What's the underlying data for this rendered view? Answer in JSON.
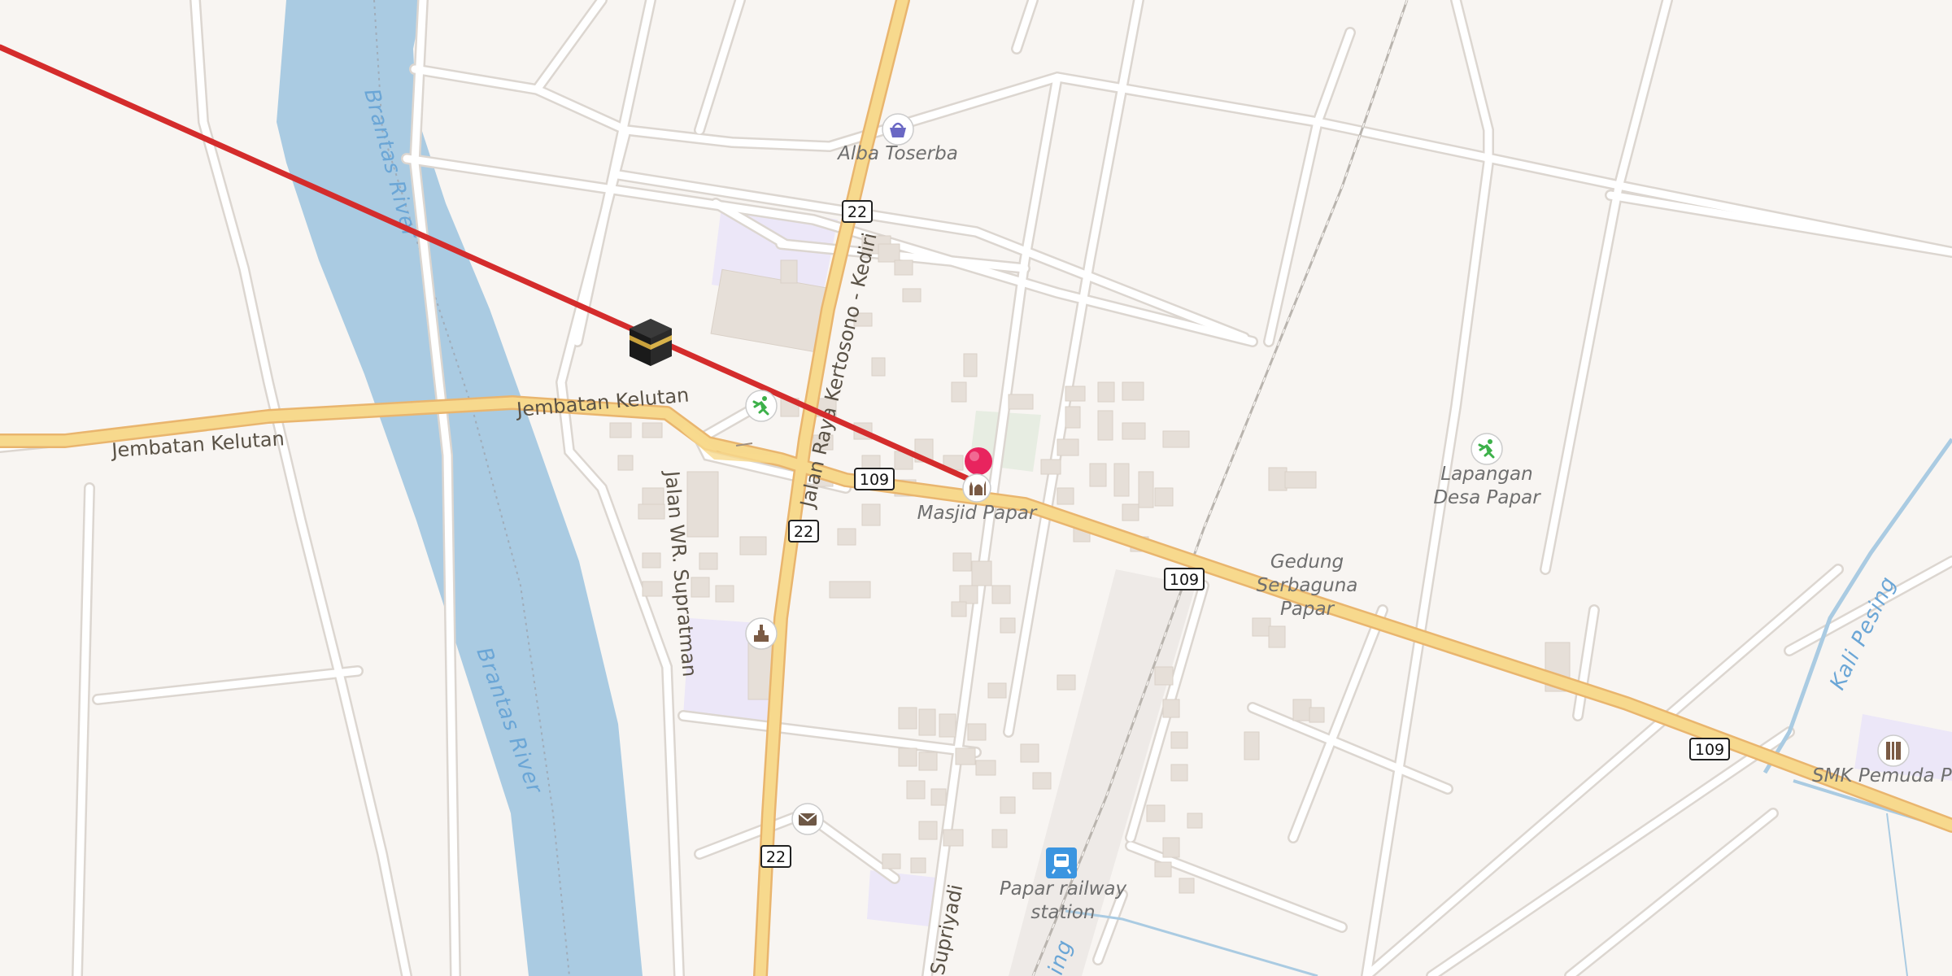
{
  "roads": {
    "jembatan_kelutan_west": "Jembatan Kelutan",
    "jembatan_kelutan_east": "Jembatan Kelutan",
    "jalan_raya": "Jalan Raya Kertosono - Kediri",
    "wr_supratman": "Jalan WR. Supratman",
    "supriyadi": "Supriyadi"
  },
  "waterways": {
    "brantas_upper": "Brantas River",
    "brantas_lower": "Brantas River",
    "kali_pesing": "Kali Pesing",
    "canal_partial": "ing"
  },
  "pois": {
    "alba": "Alba Toserba",
    "masjid": "Masjid Papar",
    "lapangan_1": "Lapangan",
    "lapangan_2": "Desa Papar",
    "gedung_1": "Gedung",
    "gedung_2": "Serbaguna",
    "gedung_3": "Papar",
    "railway_1": "Papar railway",
    "railway_2": "station",
    "smk": "SMK Pemuda Pap"
  },
  "shields": {
    "r22_a": "22",
    "r22_b": "22",
    "r22_c": "22",
    "r109_a": "109",
    "r109_b": "109",
    "r109_c": "109"
  },
  "icons": {
    "kaaba": "kaaba-icon",
    "location_pin": "location-pin-icon",
    "shop": "shopping-basket-icon",
    "sports": "running-person-icon",
    "mosque": "mosque-icon",
    "monument": "monument-icon",
    "post": "post-office-icon",
    "railway": "train-icon",
    "school": "school-icon"
  },
  "colors": {
    "route_line": "#d42c2c",
    "pin": "#e8245e",
    "river": "#aacbe2",
    "major_road": "#f7d98d",
    "land": "#f8f5f2",
    "school_area": "#ece7f8"
  }
}
